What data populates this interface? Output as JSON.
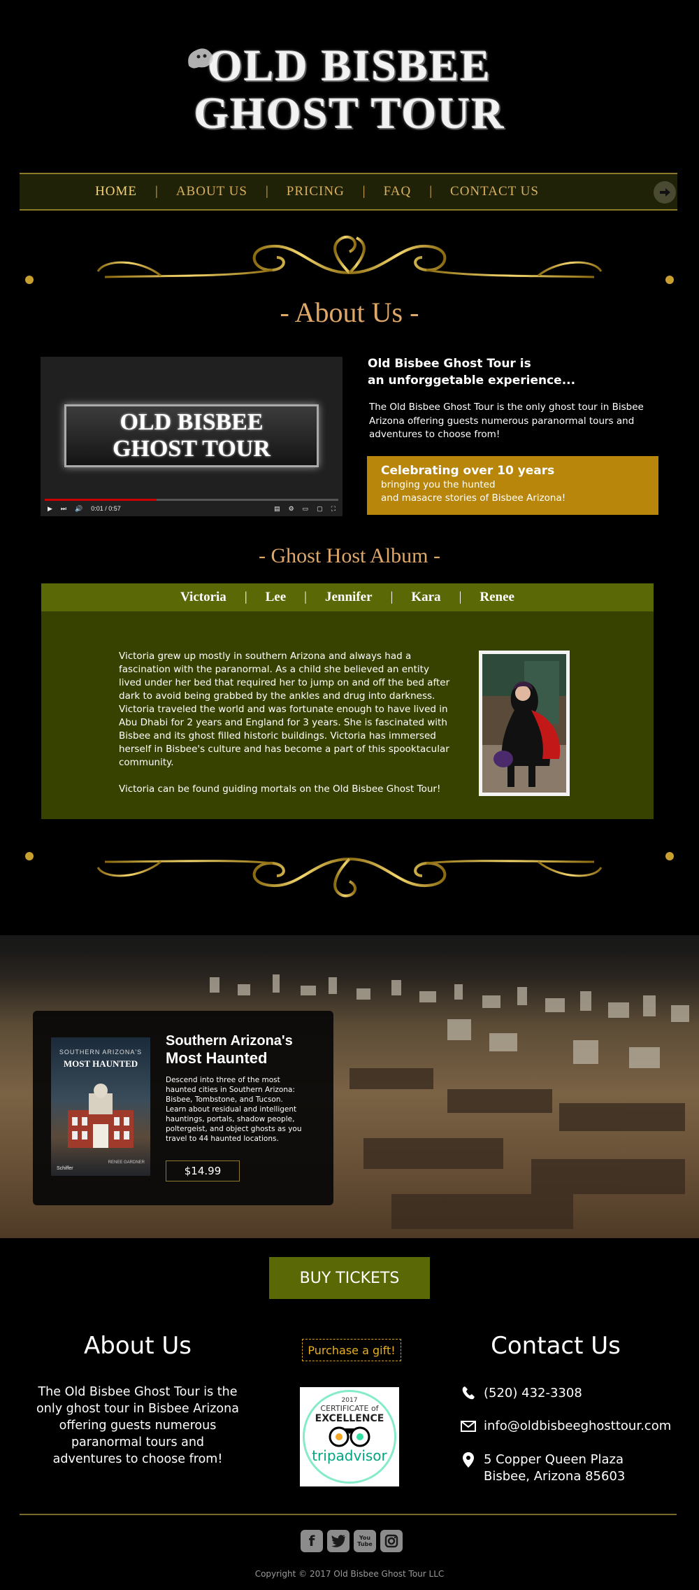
{
  "header": {
    "logo_line1": "OLD BISBEE",
    "logo_line2": "GHOST TOUR"
  },
  "nav": {
    "items": [
      {
        "label": "HOME",
        "active": true
      },
      {
        "label": "ABOUT US",
        "active": false
      },
      {
        "label": "PRICING",
        "active": false
      },
      {
        "label": "FAQ",
        "active": false
      },
      {
        "label": "CONTACT US",
        "active": false
      }
    ],
    "separator": "|",
    "arrow_icon": "arrow-right-circle-icon"
  },
  "about": {
    "title": "- About Us -",
    "video": {
      "logo_line1": "OLD BISBEE",
      "logo_line2": "GHOST TOUR",
      "time": "0:01 / 0:57",
      "progress": 0.38
    },
    "heading_line1": "Old Bisbee Ghost Tour is",
    "heading_line2": "an unforggetable experience...",
    "text": "The Old Bisbee Ghost Tour is the only ghost tour in Bisbee Arizona offering guests numerous paranormal tours and adventures to choose from!",
    "celebrate_title": "Celebrating over 10 years",
    "celebrate_line1": "bringing you the hunted",
    "celebrate_line2": "and masacre stories of Bisbee Arizona!"
  },
  "album": {
    "title": "- Ghost Host Album -",
    "tabs": [
      "Victoria",
      "Lee",
      "Jennifer",
      "Kara",
      "Renee"
    ],
    "bio_p1": "Victoria grew up mostly in southern Arizona and always had a fascination with the paranormal. As a child she believed an entity lived under her bed that required her to jump on and off the bed after dark to avoid being grabbed by the ankles and drug into darkness. Victoria traveled the world and was fortunate enough to have lived in Abu Dhabi for 2 years and England for 3 years. She is fascinated with Bisbee and its ghost filled historic buildings. Victoria has immersed herself in Bisbee's culture and has become a part of this spooktacular community.",
    "bio_p2": "Victoria can be found guiding mortals on the Old Bisbee Ghost Tour!"
  },
  "book": {
    "cover_top": "SOUTHERN ARIZONA'S",
    "cover_title": "MOST HAUNTED",
    "cover_author": "RENEE GARDNER",
    "cover_publisher": "Schiffer",
    "subtitle": "Southern Arizona's",
    "title": "Most Haunted",
    "description": "Descend into three of the most haunted cities in Southern Arizona: Bisbee, Tombstone, and Tucson. Learn about residual and intelligent hauntings, portals, shadow people, poltergeist, and object ghosts as you travel to 44 haunted locations.",
    "price": "$14.99"
  },
  "buy_tickets": "BUY TICKETS",
  "footer": {
    "about_title": "About Us",
    "about_text": "The Old Bisbee Ghost Tour is  the only ghost tour in Bisbee Arizona offering guests numerous paranormal tours and adventures to choose from!",
    "gift": "Purchase a gift!",
    "cert_year": "2017",
    "cert_line1": "CERTIFICATE of",
    "cert_line2": "EXCELLENCE",
    "cert_brand": "tripadvisor",
    "contact_title": "Contact Us",
    "phone": "(520) 432-3308",
    "email": "info@oldbisbeeghosttour.com",
    "address_line1": "5 Copper Queen Plaza",
    "address_line2": "Bisbee, Arizona 85603",
    "social": [
      "facebook-icon",
      "twitter-icon",
      "youtube-icon",
      "instagram-icon"
    ],
    "social_youtube_label": "You Tube",
    "copyright": "Copyright © 2017 Old Bisbee Ghost Tour LLC"
  },
  "colors": {
    "accent_gold": "#d9b060",
    "olive": "#5b6806",
    "panel_olive": "#384200",
    "celebrate_gold": "#b8860b"
  }
}
